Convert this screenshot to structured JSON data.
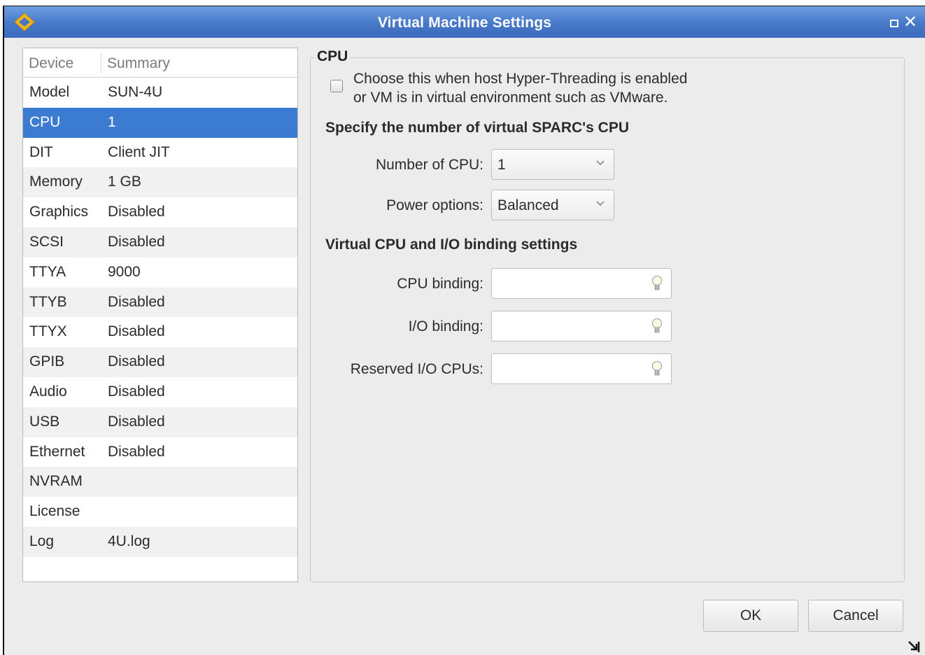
{
  "window": {
    "title": "Virtual Machine Settings",
    "icon": "app-logo-icon",
    "controls": [
      "maximize-icon",
      "close-icon"
    ],
    "close_glyph": "✕"
  },
  "device_table": {
    "columns": [
      "Device",
      "Summary"
    ],
    "selected_index": 1,
    "rows": [
      {
        "device": "Model",
        "summary": "SUN-4U"
      },
      {
        "device": "CPU",
        "summary": "1"
      },
      {
        "device": "DIT",
        "summary": "Client JIT"
      },
      {
        "device": "Memory",
        "summary": "1 GB"
      },
      {
        "device": "Graphics",
        "summary": "Disabled"
      },
      {
        "device": "SCSI",
        "summary": "Disabled"
      },
      {
        "device": "TTYA",
        "summary": "9000"
      },
      {
        "device": "TTYB",
        "summary": "Disabled"
      },
      {
        "device": "TTYX",
        "summary": "Disabled"
      },
      {
        "device": "GPIB",
        "summary": "Disabled"
      },
      {
        "device": "Audio",
        "summary": "Disabled"
      },
      {
        "device": "USB",
        "summary": "Disabled"
      },
      {
        "device": "Ethernet",
        "summary": "Disabled"
      },
      {
        "device": "NVRAM",
        "summary": ""
      },
      {
        "device": "License",
        "summary": ""
      },
      {
        "device": "Log",
        "summary": "4U.log"
      }
    ]
  },
  "cpu_panel": {
    "group_title": "CPU",
    "hyperthreading": {
      "checked": false,
      "line1": "Choose this when host Hyper-Threading is enabled",
      "line2": "or VM is in virtual environment such as VMware."
    },
    "section1_title": "Specify the number of virtual SPARC's CPU",
    "num_cpu": {
      "label": "Number of CPU:",
      "value": "1"
    },
    "power": {
      "label": "Power options:",
      "value": "Balanced"
    },
    "section2_title": "Virtual CPU and I/O binding settings",
    "cpu_binding": {
      "label": "CPU binding:",
      "value": ""
    },
    "io_binding": {
      "label": "I/O  binding:",
      "value": ""
    },
    "reserved_io": {
      "label": "Reserved I/O CPUs:",
      "value": ""
    }
  },
  "buttons": {
    "ok": "OK",
    "cancel": "Cancel"
  },
  "colors": {
    "titlebar": "#4678c8",
    "selection": "#3b7bd2",
    "background": "#ececec"
  }
}
